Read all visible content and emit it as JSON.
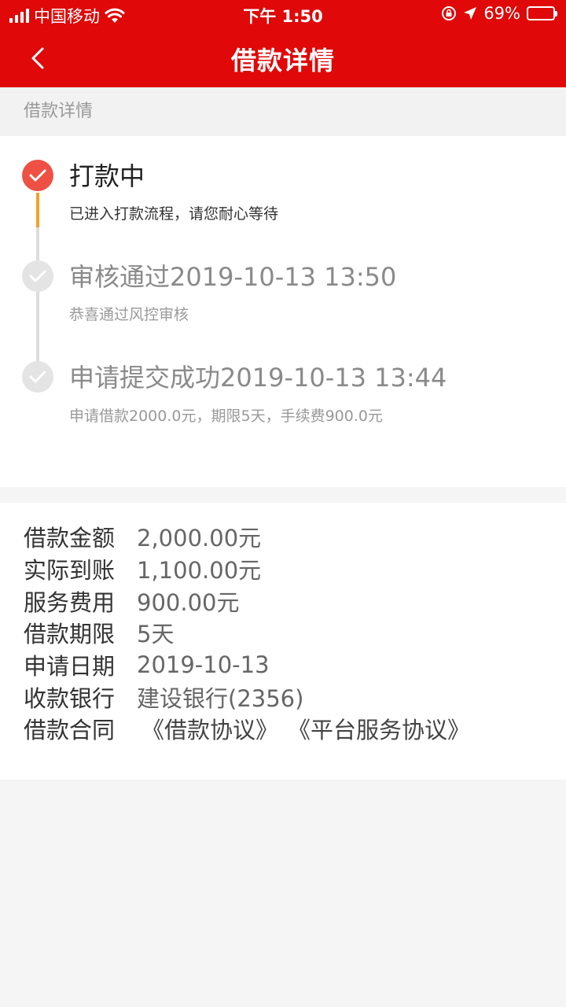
{
  "status_bar": {
    "carrier": "中国移动",
    "time": "下午 1:50",
    "battery": "69%"
  },
  "nav": {
    "title": "借款详情",
    "back_icon": "chevron-left-icon"
  },
  "section_label": "借款详情",
  "timeline": [
    {
      "title": "打款中",
      "desc": "已进入打款流程，请您耐心等待",
      "state": "active",
      "icon": "check-icon"
    },
    {
      "title": "审核通过2019-10-13 13:50",
      "desc": "恭喜通过风控审核",
      "state": "done",
      "icon": "check-icon"
    },
    {
      "title": "申请提交成功2019-10-13 13:44",
      "desc": "申请借款2000.0元，期限5天，手续费900.0元",
      "state": "done",
      "icon": "check-icon"
    }
  ],
  "details": [
    {
      "label": "借款金额",
      "value": "2,000.00元"
    },
    {
      "label": "实际到账",
      "value": "1,100.00元"
    },
    {
      "label": "服务费用",
      "value": "900.00元"
    },
    {
      "label": "借款期限",
      "value": "5天"
    },
    {
      "label": "申请日期",
      "value": "2019-10-13"
    },
    {
      "label": "收款银行",
      "value": "建设银行(2356)"
    }
  ],
  "contract": {
    "label": "借款合同",
    "links": [
      "《借款协议》",
      "《平台服务协议》"
    ]
  },
  "colors": {
    "header": "#e00808",
    "active_node": "#ee5044",
    "active_line": "#f0a12a",
    "inactive": "#dddddd"
  }
}
